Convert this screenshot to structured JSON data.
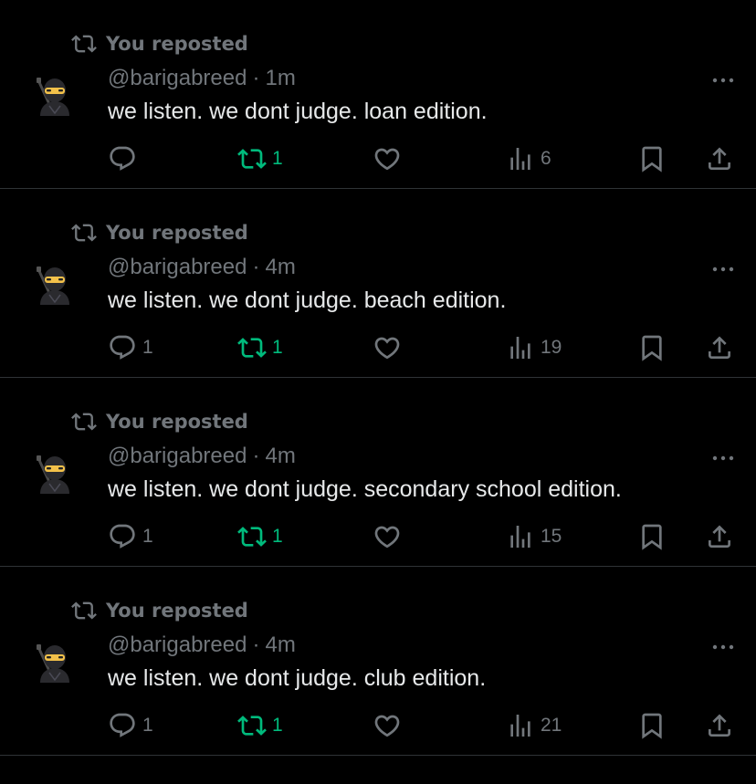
{
  "colors": {
    "background": "#000000",
    "muted": "#71767b",
    "text": "#e7e9ea",
    "repost_green": "#00ba7c",
    "divider": "#2f3336"
  },
  "posts": [
    {
      "repost_label": "You reposted",
      "handle": "@barigabreed",
      "separator": "·",
      "time": "1m",
      "text": "we listen. we dont judge. loan edition.",
      "avatar": "ninja-emoji",
      "reply_count": "",
      "repost_count": "1",
      "view_count": "6"
    },
    {
      "repost_label": "You reposted",
      "handle": "@barigabreed",
      "separator": "·",
      "time": "4m",
      "text": "we listen. we dont judge. beach edition.",
      "avatar": "ninja-emoji",
      "reply_count": "1",
      "repost_count": "1",
      "view_count": "19"
    },
    {
      "repost_label": "You reposted",
      "handle": "@barigabreed",
      "separator": "·",
      "time": "4m",
      "text": "we listen. we dont judge. secondary school edition.",
      "avatar": "ninja-emoji",
      "reply_count": "1",
      "repost_count": "1",
      "view_count": "15"
    },
    {
      "repost_label": "You reposted",
      "handle": "@barigabreed",
      "separator": "·",
      "time": "4m",
      "text": "we listen. we dont judge. club edition.",
      "avatar": "ninja-emoji",
      "reply_count": "1",
      "repost_count": "1",
      "view_count": "21"
    }
  ]
}
